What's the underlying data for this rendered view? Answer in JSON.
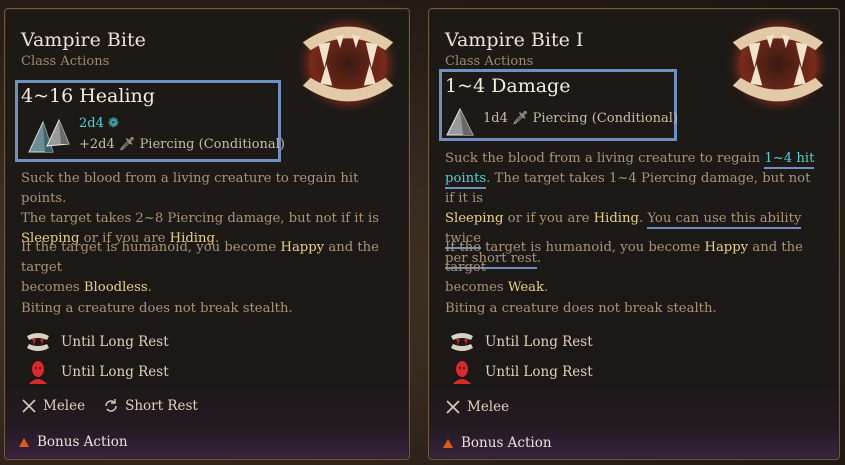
{
  "left": {
    "title": "Vampire Bite",
    "subtitle": "Class Actions",
    "effect": "4~16 Healing",
    "dice_main": "2d4",
    "dice_secondary": "+2d4",
    "damage_type": "Piercing (Conditional)",
    "desc1_a": "Suck the blood from a living creature to regain hit points.",
    "desc1_b": "The target takes 2~8 Piercing damage, but not if it is",
    "kw_sleeping": "Sleeping",
    "desc1_c": " or if you are ",
    "kw_hiding": "Hiding",
    "desc1_d": ".",
    "desc2_a": "If the target is humanoid, you become ",
    "kw_happy": "Happy",
    "desc2_b": " and the target",
    "desc2_c": "becomes ",
    "kw_bloodless": "Bloodless",
    "desc2_d": ".",
    "desc3": "Biting a creature does not break stealth.",
    "cond1": "Until Long Rest",
    "cond2": "Until Long Rest",
    "range": "Melee",
    "recharge": "Short Rest",
    "action_type": "Bonus Action"
  },
  "right": {
    "title": "Vampire Bite I",
    "subtitle": "Class Actions",
    "effect": "1~4 Damage",
    "dice_main": "1d4",
    "damage_type": "Piercing (Conditional)",
    "desc1_a": "Suck the blood from a living creature to regain ",
    "hl_hit": "1~4 hit",
    "hl_points": "points",
    "desc1_b": ". The target takes 1~4 Piercing damage, but not if it is",
    "kw_sleeping": "Sleeping",
    "desc1_c": " or if you are ",
    "kw_hiding": "Hiding",
    "desc1_d": ". ",
    "extra_a": "You can use this ability twice",
    "extra_b": "per short rest",
    "desc1_e": ".",
    "desc2_a": "If the target is humanoid, you become ",
    "kw_happy": "Happy",
    "desc2_b": " and the target",
    "desc2_c": "becomes ",
    "kw_weak": "Weak",
    "desc2_d": ".",
    "desc3": "Biting a creature does not break stealth.",
    "cond1": "Until Long Rest",
    "cond2": "Until Long Rest",
    "range": "Melee",
    "action_type": "Bonus Action"
  },
  "colors": {
    "highlight_box": "#6f8fbf",
    "keyword": "#e8d28a",
    "accent_cyan": "#4fd0d4",
    "bonus_triangle": "#e05a1a"
  },
  "icons": [
    "fangs-icon",
    "crystal-d4-icon",
    "dagger-icon",
    "fang-mark-icon",
    "red-head-icon",
    "crossed-swords-icon",
    "recharge-icon",
    "bonus-action-icon",
    "heal-icon"
  ]
}
